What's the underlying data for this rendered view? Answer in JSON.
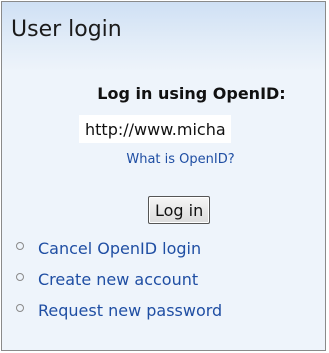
{
  "block": {
    "title": "User login"
  },
  "openid_form": {
    "label": "Log in using OpenID:",
    "input_value": "http://www.michael",
    "what_is_link": "What is OpenID?",
    "submit_label": "Log in"
  },
  "links": [
    {
      "label": "Cancel OpenID login"
    },
    {
      "label": "Create new account"
    },
    {
      "label": "Request new password"
    }
  ],
  "colors": {
    "link": "#1f4ea3",
    "block_background": "#eef4fb",
    "title_gradient_top": "#cfe0f4"
  },
  "icons": {
    "list_bullet": "hollow-circle-bullet-icon"
  }
}
